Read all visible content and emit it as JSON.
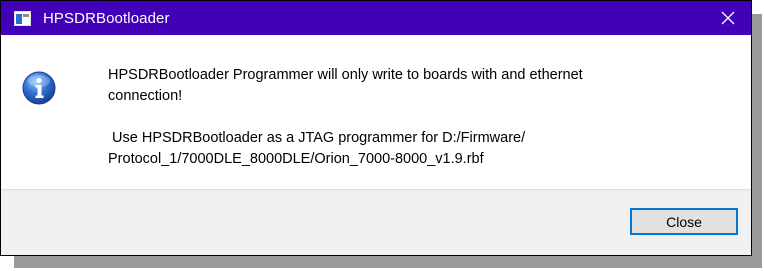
{
  "window": {
    "title": "HPSDRBootloader",
    "app_icon": "application-icon",
    "close_icon": "close-icon",
    "titlebar_color": "#4200b8"
  },
  "message": {
    "icon": "information-icon",
    "paragraph1_line1": "HPSDRBootloader Programmer will only write to boards with and ethernet",
    "paragraph1_line2": "connection!",
    "paragraph2_line1": " Use HPSDRBootloader as a JTAG programmer for D:/Firmware/",
    "paragraph2_line2": "Protocol_1/7000DLE_8000DLE/Orion_7000-8000_v1.9.rbf"
  },
  "buttons": {
    "close_label": "Close",
    "accent_color": "#0078d7"
  }
}
